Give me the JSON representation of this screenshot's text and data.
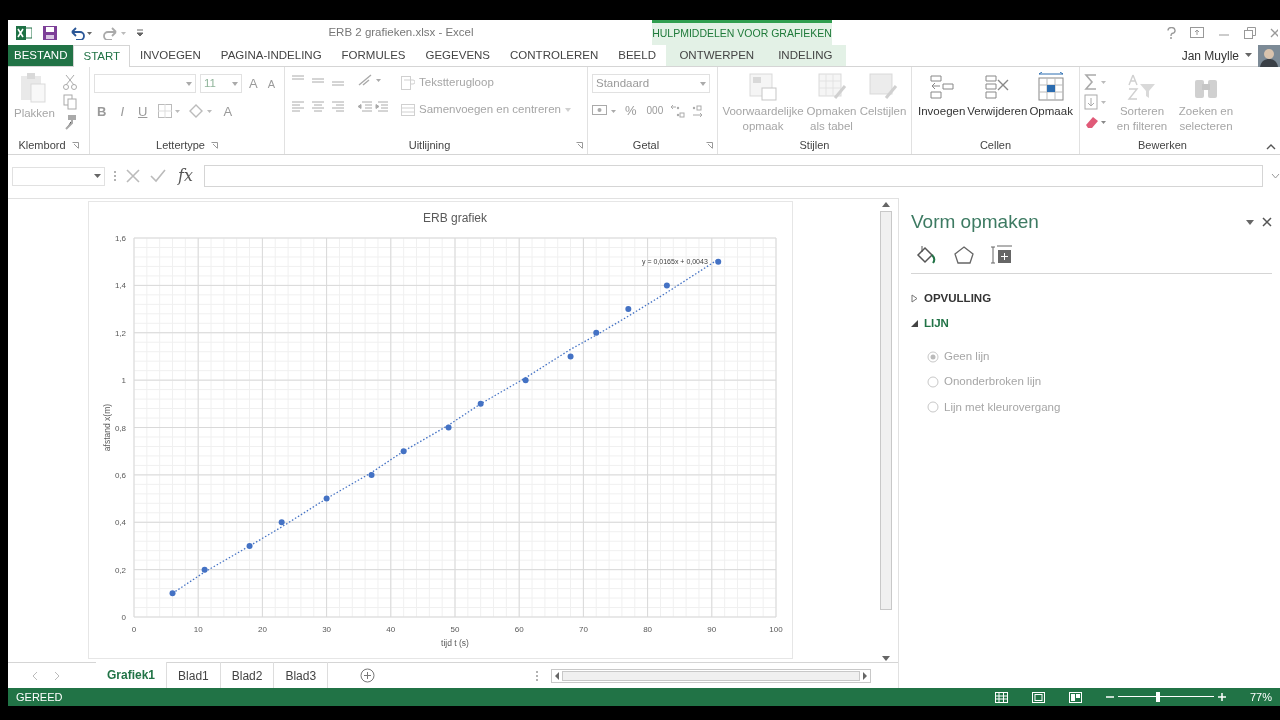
{
  "window": {
    "title": "ERB 2 grafieken.xlsx - Excel",
    "contextual_group": "HULPMIDDELEN VOOR GRAFIEKEN",
    "user": "Jan Muylle"
  },
  "tabs": [
    {
      "label": "BESTAND",
      "kind": "file",
      "selected": false
    },
    {
      "label": "START",
      "kind": "normal",
      "selected": true
    },
    {
      "label": "INVOEGEN",
      "kind": "normal",
      "selected": false
    },
    {
      "label": "PAGINA-INDELING",
      "kind": "normal",
      "selected": false
    },
    {
      "label": "FORMULES",
      "kind": "normal",
      "selected": false
    },
    {
      "label": "GEGEVENS",
      "kind": "normal",
      "selected": false
    },
    {
      "label": "CONTROLEREN",
      "kind": "normal",
      "selected": false
    },
    {
      "label": "BEELD",
      "kind": "normal",
      "selected": false
    },
    {
      "label": "ONTWERPEN",
      "kind": "contextual",
      "selected": false
    },
    {
      "label": "INDELING",
      "kind": "contextual",
      "selected": false
    }
  ],
  "ribbon": {
    "groups": [
      {
        "label": "Klembord",
        "commands": [
          {
            "label": "Plakken",
            "disabled": true
          }
        ]
      },
      {
        "label": "Lettertype",
        "font_size": "11",
        "glyphs": [
          "A",
          "A",
          "B",
          "I",
          "U",
          "A"
        ]
      },
      {
        "label": "Uitlijning",
        "commands": [
          {
            "label": "Tekstterugloop",
            "disabled": true
          },
          {
            "label": "Samenvoegen en centreren",
            "disabled": true
          }
        ]
      },
      {
        "label": "Getal",
        "number_format": "Standaard",
        "glyphs": [
          "%",
          "000"
        ]
      },
      {
        "label": "Stijlen",
        "commands": [
          {
            "label": "Voorwaardelijke opmaak",
            "disabled": true
          },
          {
            "label": "Opmaken als tabel",
            "disabled": true
          },
          {
            "label": "Celstijlen",
            "disabled": true
          }
        ]
      },
      {
        "label": "Cellen",
        "commands": [
          {
            "label": "Invoegen",
            "disabled": false
          },
          {
            "label": "Verwijderen",
            "disabled": false
          },
          {
            "label": "Opmaak",
            "disabled": false
          }
        ]
      },
      {
        "label": "Bewerken",
        "commands": [
          {
            "label": "Sorteren en filteren",
            "disabled": true
          },
          {
            "label": "Zoeken en selecteren",
            "disabled": true
          }
        ]
      }
    ]
  },
  "formula_bar": {
    "fx": "fx"
  },
  "chart": {
    "chart_data": {
      "type": "scatter",
      "title": "ERB grafiek",
      "xlabel": "tijd t (s)",
      "ylabel": "afstand x(m)",
      "x": [
        6,
        11,
        18,
        23,
        30,
        37,
        42,
        49,
        54,
        61,
        68,
        72,
        77,
        83,
        91
      ],
      "grid": true,
      "series": [
        {
          "color": "#4472c4",
          "values": [
            0.1,
            0.2,
            0.3,
            0.4,
            0.5,
            0.6,
            0.7,
            0.8,
            0.9,
            1.0,
            1.1,
            1.2,
            1.3,
            1.4,
            1.5
          ]
        },
        {
          "type": "line",
          "line_style": "dotted",
          "color": "#4472c4",
          "values": [
            0.1,
            0.19,
            0.3,
            0.38,
            0.5,
            0.61,
            0.7,
            0.81,
            0.9,
            1.01,
            1.13,
            1.19,
            1.27,
            1.37,
            1.51
          ]
        }
      ],
      "xlim": [
        0,
        100
      ],
      "ylim": [
        0,
        1.6
      ],
      "xticks": [
        0,
        10,
        20,
        30,
        40,
        50,
        60,
        70,
        80,
        90,
        100
      ],
      "yticks": [
        {
          "value": 0,
          "label": "0"
        },
        {
          "value": 0.2,
          "label": "0,2"
        },
        {
          "value": 0.4,
          "label": "0,4"
        },
        {
          "value": 0.6,
          "label": "0,6"
        },
        {
          "value": 0.8,
          "label": "0,8"
        },
        {
          "value": 1,
          "label": "1"
        },
        {
          "value": 1.2,
          "label": "1,2"
        },
        {
          "value": 1.4,
          "label": "1,4"
        },
        {
          "value": 1.6,
          "label": "1,6"
        }
      ],
      "annotations": [
        "y = 0,0165x + 0,0043"
      ]
    }
  },
  "sheets": [
    {
      "label": "Grafiek1",
      "selected": true
    },
    {
      "label": "Blad1",
      "selected": false
    },
    {
      "label": "Blad2",
      "selected": false
    },
    {
      "label": "Blad3",
      "selected": false
    }
  ],
  "panel": {
    "title": "Vorm opmaken",
    "sections": [
      {
        "label": "OPVULLING",
        "expanded": false
      },
      {
        "label": "LIJN",
        "expanded": true,
        "options": [
          {
            "label": "Geen lijn",
            "selected": true,
            "disabled": true
          },
          {
            "label": "Ononderbroken lijn",
            "selected": false,
            "disabled": true
          },
          {
            "label": "Lijn met kleurovergang",
            "selected": false,
            "disabled": true
          }
        ]
      }
    ]
  },
  "status_bar": {
    "status": "GEREED",
    "zoom": {
      "level": 0.41,
      "reading": "77%"
    }
  }
}
